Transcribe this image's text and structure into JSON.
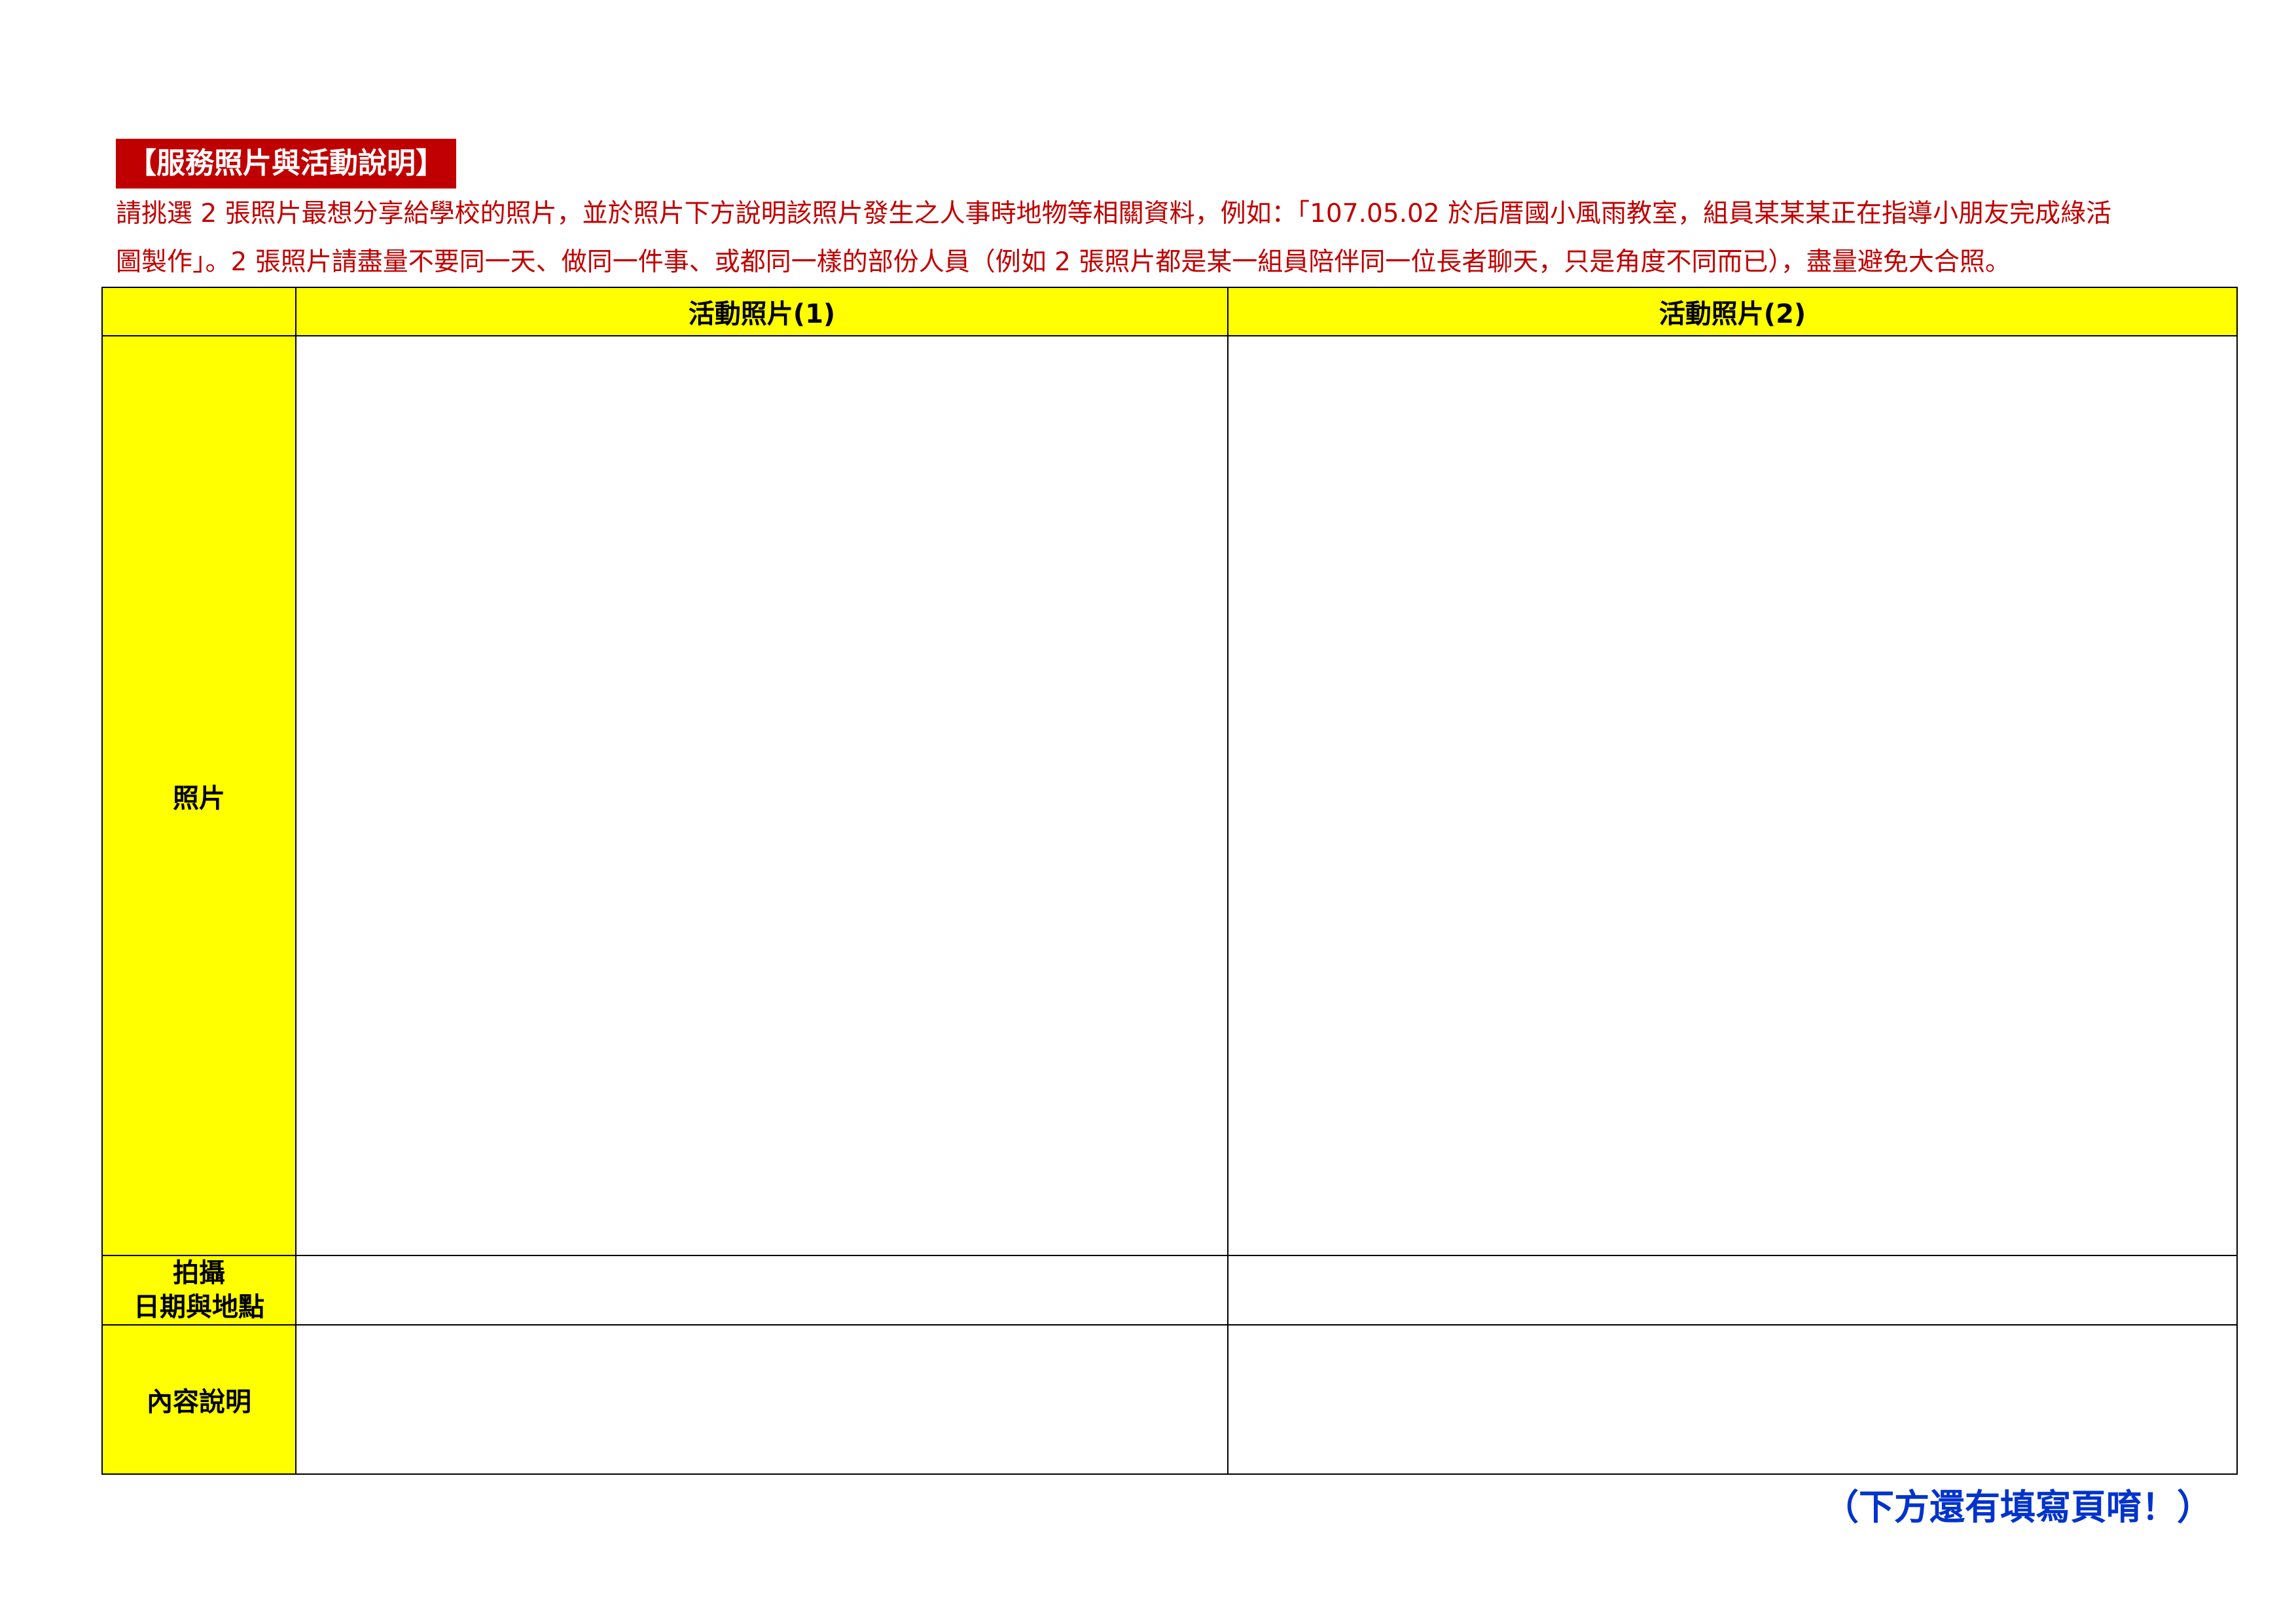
{
  "section": {
    "title": "【服務照片與活動說明】"
  },
  "instructions": {
    "line1": "請挑選 2 張照片最想分享給學校的照片，並於照片下方說明該照片發生之人事時地物等相關資料，例如：「107.05.02 於后厝國小風雨教室，組員某某某正在指導小朋友完成綠活",
    "line2": "圖製作」。2 張照片請盡量不要同一天、做同一件事、或都同一樣的部份人員（例如 2 張照片都是某一組員陪伴同一位長者聊天，只是角度不同而已），盡量避免大合照。"
  },
  "table": {
    "col1_header": "活動照片(1)",
    "col2_header": "活動照片(2)",
    "row_photo_label": "照片",
    "row_date_label_line1": "拍攝",
    "row_date_label_line2": "日期與地點",
    "row_content_label": "內容說明"
  },
  "footer": {
    "note": "（下方還有填寫頁唷！）"
  },
  "colors": {
    "title_bg": "#c00000",
    "instruction_text": "#c00000",
    "header_fill": "#ffff00",
    "footer_text": "#0033cc"
  }
}
